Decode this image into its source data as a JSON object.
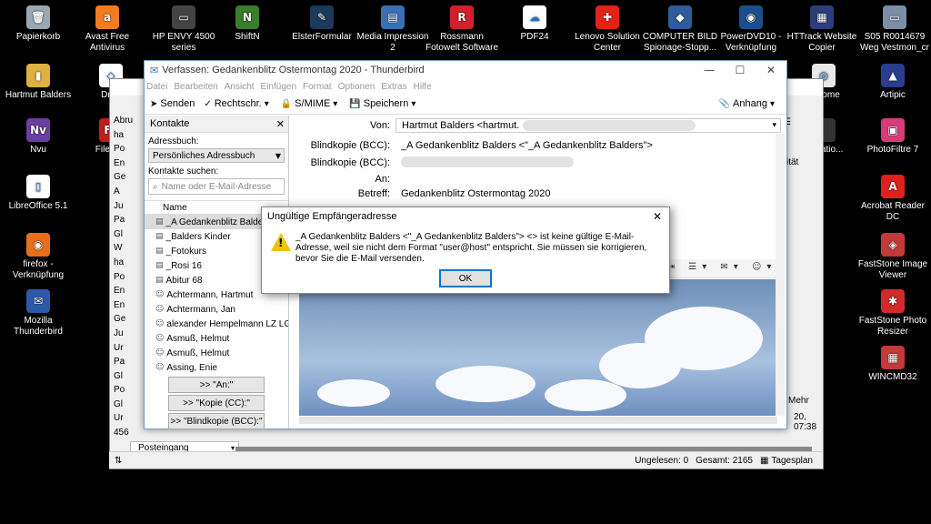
{
  "desktop": {
    "icons": [
      {
        "label": "Papierkorb",
        "color": "#9aa7b3",
        "glyph": "🗑"
      },
      {
        "label": "Avast Free Antivirus",
        "color": "#f47b20",
        "glyph": "a"
      },
      {
        "label": "HP ENVY 4500 series",
        "color": "#444",
        "glyph": "▭"
      },
      {
        "label": "ShiftN",
        "color": "#3a7d2b",
        "glyph": "N"
      },
      {
        "label": "ElsterFormular",
        "color": "#1b3a5c",
        "glyph": "✎"
      },
      {
        "label": "Media Impression 2",
        "color": "#3b6fb5",
        "glyph": "▤"
      },
      {
        "label": "Rossmann Fotowelt Software",
        "color": "#d3202a",
        "glyph": "R"
      },
      {
        "label": "PDF24",
        "color": "#ffffff",
        "glyph": "☁"
      },
      {
        "label": "Lenovo Solution Center",
        "color": "#e2231a",
        "glyph": "✚"
      },
      {
        "label": "COMPUTER BILD Spionage-Stopp...",
        "color": "#2f5c9a",
        "glyph": "◆"
      },
      {
        "label": "PowerDVD10 - Verknüpfung",
        "color": "#1b4f8c",
        "glyph": "◉"
      },
      {
        "label": "HTTrack Website Copier",
        "color": "#2c3e7a",
        "glyph": "▦"
      },
      {
        "label": "S05 R0014679 Weg Vestmon_cr",
        "color": "#7a8fa6",
        "glyph": "▭"
      },
      {
        "label": "Hartmut Balders",
        "color": "#e0b040",
        "glyph": "▮"
      },
      {
        "label": "Drop",
        "color": "#ffffff",
        "glyph": "◇"
      },
      {
        "label": "Chrome",
        "color": "#e8e8e8",
        "glyph": "◎"
      },
      {
        "label": "Artipic",
        "color": "#2a3d8f",
        "glyph": "▲"
      },
      {
        "label": "Nvu",
        "color": "#6b3fa0",
        "glyph": "Nv"
      },
      {
        "label": "FileZilla",
        "color": "#bf1e1e",
        "glyph": "Fz"
      },
      {
        "label": "...tivatio...",
        "color": "#333",
        "glyph": ""
      },
      {
        "label": "PhotoFiltre 7",
        "color": "#d43c7a",
        "glyph": "▣"
      },
      {
        "label": "LibreOffice 5.1",
        "color": "#ffffff",
        "glyph": "▯"
      },
      {
        "label": "Acrobat Reader DC",
        "color": "#e0201b",
        "glyph": "A"
      },
      {
        "label": "firefox - Verknüpfung",
        "color": "#e76f1c",
        "glyph": "◉"
      },
      {
        "label": "FastStone Image Viewer",
        "color": "#c23a3a",
        "glyph": "◈"
      },
      {
        "label": "Mozilla Thunderbird",
        "color": "#2d5aa8",
        "glyph": "✉"
      },
      {
        "label": "FastStone Photo Resizer",
        "color": "#d02b2b",
        "glyph": "✱"
      },
      {
        "label": "WINCMD32",
        "color": "#c43a3a",
        "glyph": "▦"
      }
    ]
  },
  "window": {
    "title": "Verfassen: Gedankenblitz Ostermontag 2020 - Thunderbird",
    "controls": [
      "—",
      "☐",
      "✕"
    ],
    "menu": [
      "Datei",
      "Bearbeiten",
      "Ansicht",
      "Einfügen",
      "Format",
      "Optionen",
      "Extras",
      "Hilfe"
    ],
    "toolbar": {
      "send": "Senden",
      "spell": "Rechtschr.",
      "smime": "S/MIME",
      "save": "Speichern",
      "attach": "Anhang"
    }
  },
  "contacts": {
    "title": "Kontakte",
    "addressbook_label": "Adressbuch:",
    "addressbook_value": "Persönliches Adressbuch",
    "search_label": "Kontakte suchen:",
    "search_placeholder": "Name oder E-Mail-Adresse",
    "column": "Name",
    "items": [
      "_A Gedankenblitz Balders",
      "_Balders Kinder",
      "_Fotokurs",
      "_Rosi 16",
      "Abitur 68",
      "Achtermann, Hartmut",
      "Achtermann, Jan",
      "alexander Hempelmann LZ LG",
      "Asmuß, Helmut",
      "Asmuß, Helmut",
      "Assing, Enie"
    ],
    "buttons": [
      ">> \"An:\"",
      ">> \"Kopie (CC):\"",
      ">> \"Blindkopie (BCC):\""
    ]
  },
  "header": {
    "from_label": "Von:",
    "from_value": "Hartmut Balders <hartmut.",
    "bcc1_label": "Blindkopie (BCC):",
    "bcc1_value": "_A Gedankenblitz Balders <\"_A Gedankenblitz Balders\">",
    "bcc2_label": "Blindkopie (BCC):",
    "to_label": "An:",
    "subject_label": "Betreff:",
    "subject_value": "Gedankenblitz Ostermontag 2020"
  },
  "dialog": {
    "title": "Ungültige Empfängeradresse",
    "message": "_A Gedankenblitz Balders <\"_A Gedankenblitz Balders\"> <> ist keine gültige E-Mail-Adresse, weil sie nicht dem Format \"user@host\" entspricht. Sie müssen sie korrigieren, bevor Sie die E-Mail versenden.",
    "ok": "OK"
  },
  "background_window": {
    "folder": "Posteingang",
    "side_letters": [
      "Abru",
      "ha",
      "Po",
      "En",
      "Ge",
      "A",
      "Ju",
      "Pa",
      "Gl",
      "W",
      "ha",
      "Po",
      "En",
      "En",
      "Ge",
      "Ju",
      "Ur",
      "Pa",
      "Gl",
      "Po",
      "Gl",
      "Ur",
      "456"
    ],
    "right_text": [
      "ität",
      "Mehr",
      "20, 07:38"
    ]
  },
  "status": {
    "unread": "Ungelesen: 0",
    "total": "Gesamt: 2165",
    "day": "Tagesplan"
  },
  "colors": {
    "accent": "#0078d7",
    "warning": "#f2c200"
  }
}
